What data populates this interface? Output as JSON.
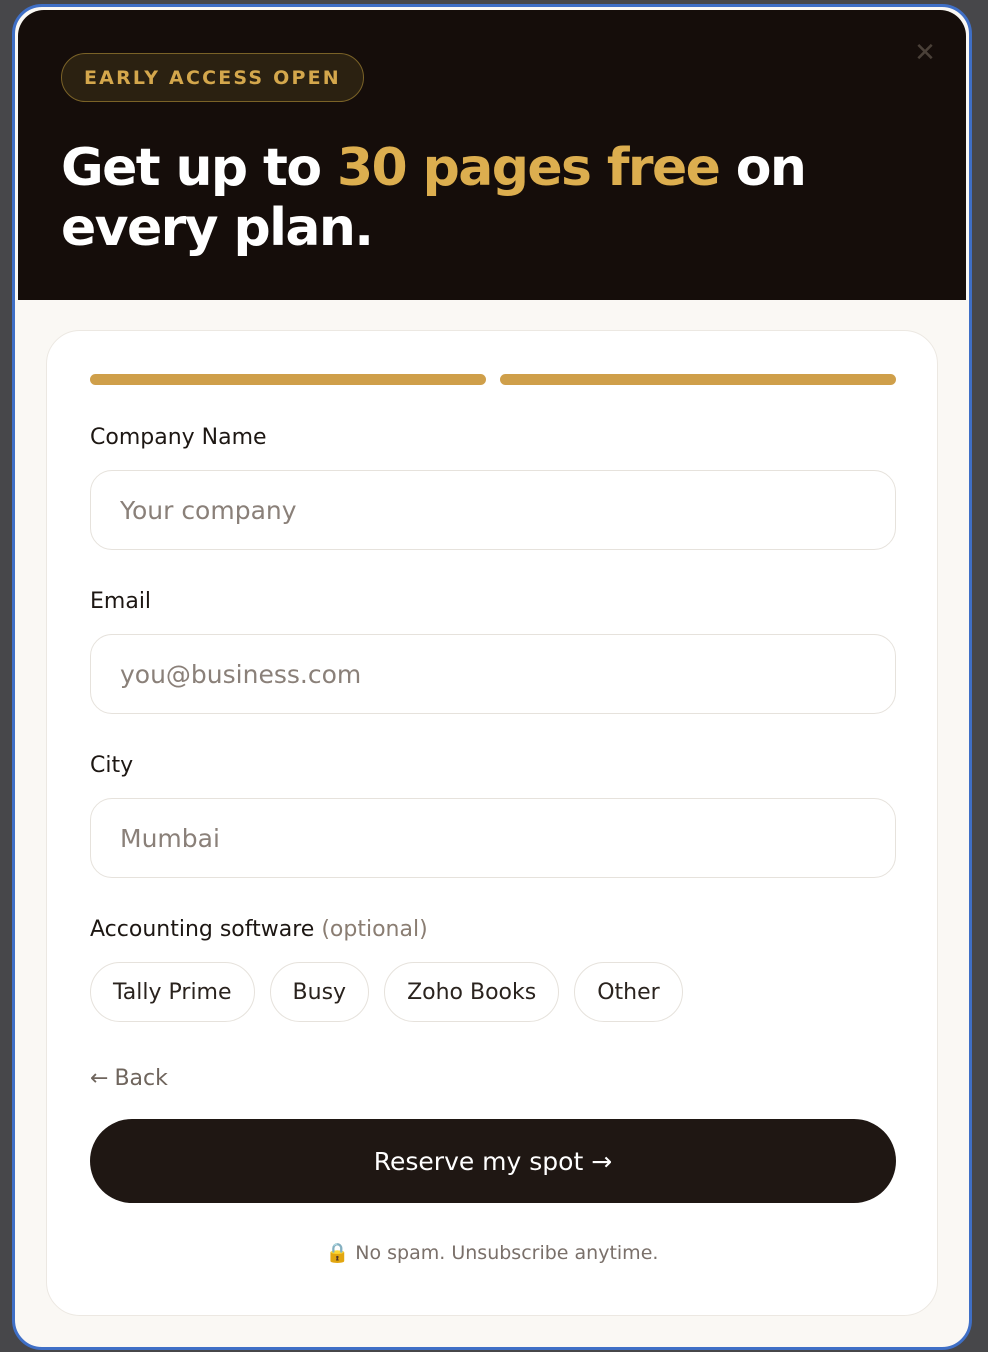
{
  "badge": "EARLY ACCESS OPEN",
  "close_glyph": "✕",
  "headline": {
    "before": "Get up to ",
    "accent": "30 pages free",
    "after": " on every plan."
  },
  "progress": {
    "current_step": 2,
    "total_steps": 2
  },
  "form": {
    "company": {
      "label": "Company Name",
      "placeholder": "Your company"
    },
    "email": {
      "label": "Email",
      "placeholder": "you@business.com"
    },
    "city": {
      "label": "City",
      "placeholder": "Mumbai"
    },
    "software": {
      "label": "Accounting software",
      "optional": "(optional)",
      "options": [
        "Tally Prime",
        "Busy",
        "Zoho Books",
        "Other"
      ]
    }
  },
  "back": {
    "arrow": "←",
    "label": "Back"
  },
  "submit": {
    "label": "Reserve my spot",
    "arrow": "→"
  },
  "note": {
    "icon": "🔒",
    "text": "No spam. Unsubscribe anytime."
  },
  "icons": {
    "close": "close-icon",
    "back": "arrow-left-icon",
    "submit": "arrow-right-icon",
    "note": "lock-icon"
  },
  "colors": {
    "hero_bg": "#150d0a",
    "accent": "#dcae4f",
    "progress": "#cf9f4a",
    "button_bg": "#1f1713",
    "modal_border": "#3f6fc6"
  }
}
